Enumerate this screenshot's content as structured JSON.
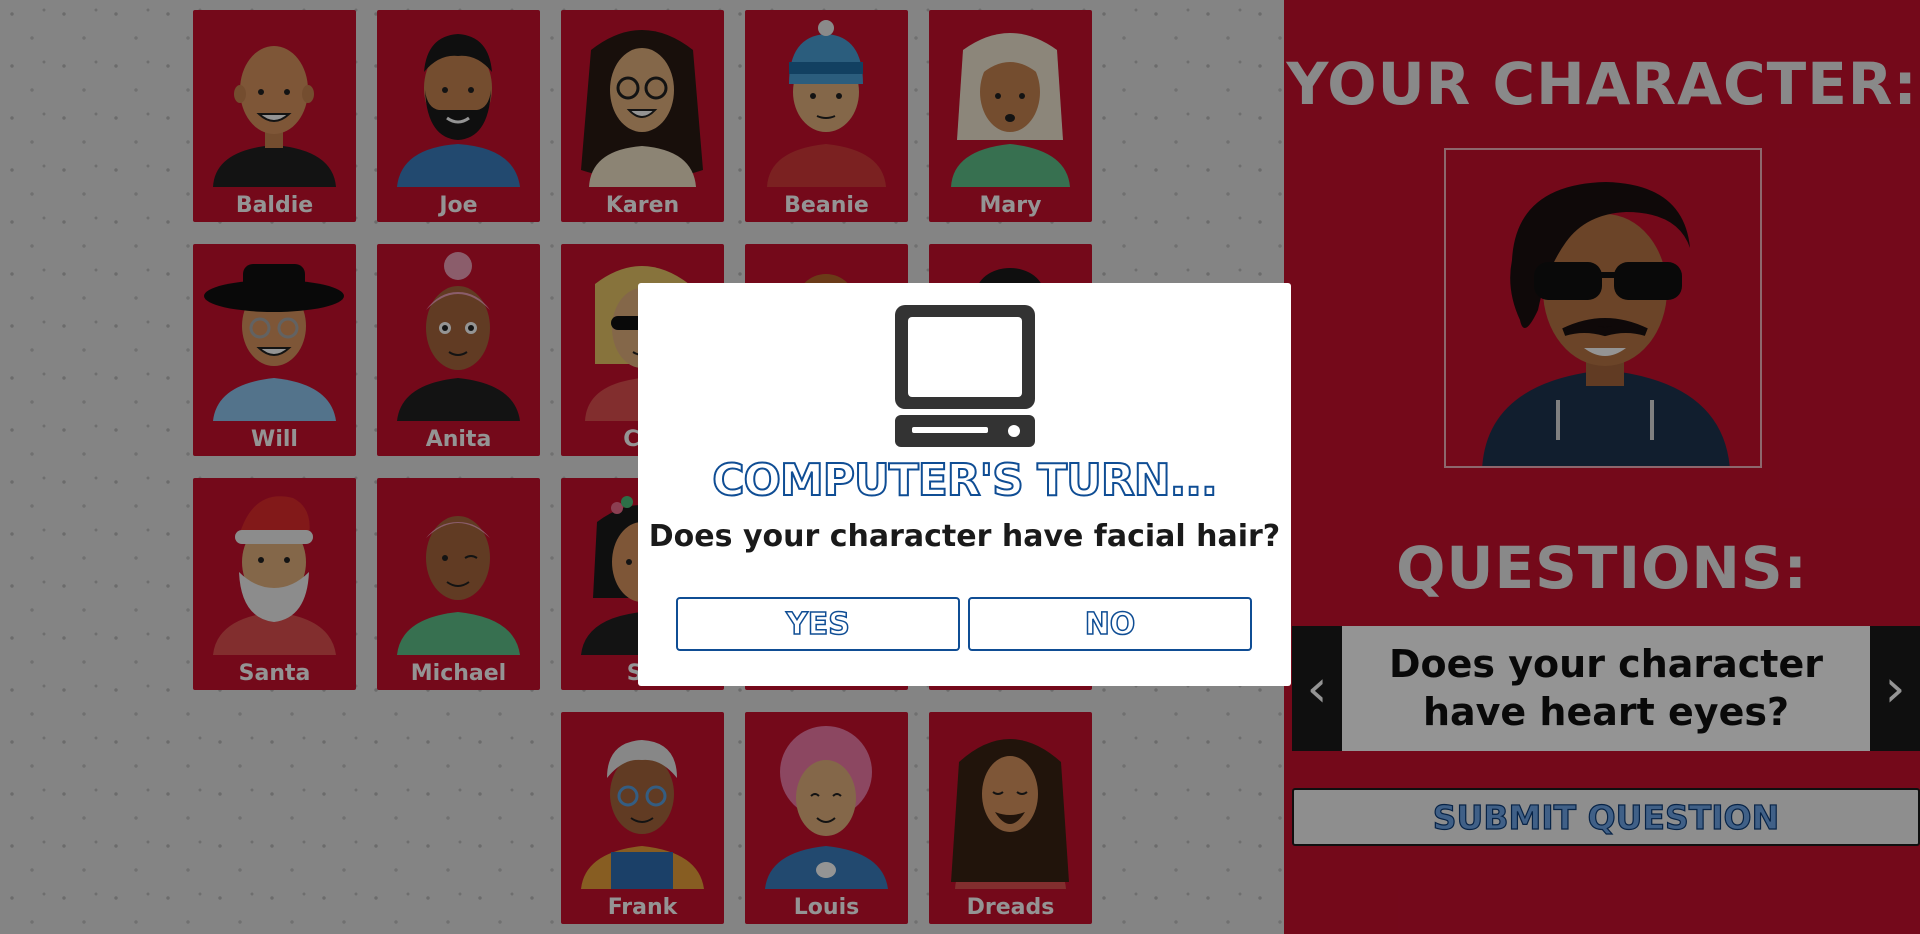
{
  "board": {
    "characters": [
      {
        "name": "Baldie"
      },
      {
        "name": "Joe"
      },
      {
        "name": "Karen"
      },
      {
        "name": "Beanie"
      },
      {
        "name": "Mary"
      },
      {
        "name": "Will"
      },
      {
        "name": "Anita"
      },
      {
        "name": "Cla"
      },
      {
        "name": "Santa"
      },
      {
        "name": "Michael"
      },
      {
        "name": "Su"
      },
      {
        "name": "Frank"
      },
      {
        "name": "Louis"
      },
      {
        "name": "Dreads"
      }
    ]
  },
  "panel": {
    "character_title": "YOUR CHARACTER:",
    "questions_title": "QUESTIONS:",
    "current_question": "Does your character have heart eyes?",
    "prev_label": "‹",
    "next_label": "›",
    "submit_label": "SUBMIT QUESTION"
  },
  "modal": {
    "title": "COMPUTER'S TURN...",
    "question": "Does your character have facial hair?",
    "yes_label": "YES",
    "no_label": "NO"
  }
}
